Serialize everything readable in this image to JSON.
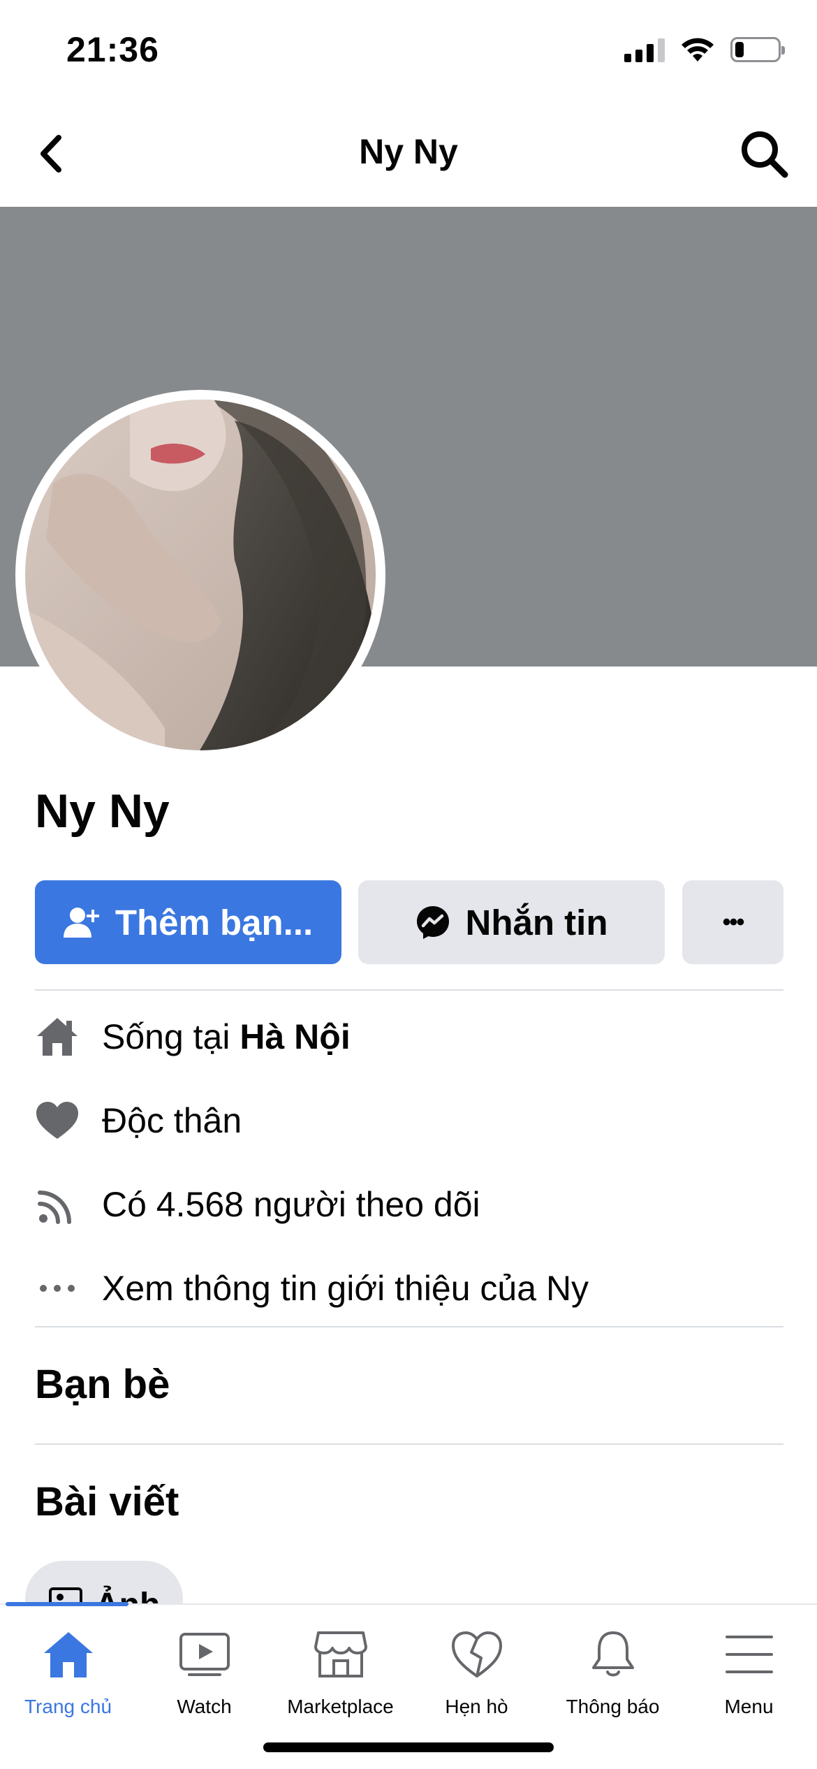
{
  "status_bar": {
    "time": "21:36",
    "battery_level": 0.2,
    "signal_icon": "signal-icon",
    "wifi_icon": "wifi-icon"
  },
  "header": {
    "title": "Ny Ny",
    "back_icon": "chevron-left-icon",
    "search_icon": "search-icon"
  },
  "profile": {
    "name": "Ny Ny",
    "cover_color": "#878a8d"
  },
  "actions": {
    "add_friend_label": "Thêm bạn...",
    "message_label": "Nhắn tin",
    "more_label": "•••"
  },
  "info": {
    "lives_prefix": "Sống tại ",
    "lives_city": "Hà Nội",
    "relationship": "Độc thân",
    "followers": "Có 4.568 người theo dõi",
    "see_about": "Xem thông tin giới thiệu của Ny"
  },
  "sections": {
    "friends_title": "Bạn bè",
    "posts_title": "Bài viết",
    "photos_chip": "Ảnh"
  },
  "tabbar": {
    "tabs": [
      {
        "label": "Trang chủ",
        "icon": "home-icon",
        "active": true
      },
      {
        "label": "Watch",
        "icon": "watch-icon",
        "active": false
      },
      {
        "label": "Marketplace",
        "icon": "marketplace-icon",
        "active": false
      },
      {
        "label": "Hẹn hò",
        "icon": "heart-icon",
        "active": false
      },
      {
        "label": "Thông báo",
        "icon": "bell-icon",
        "active": false
      },
      {
        "label": "Menu",
        "icon": "menu-icon",
        "active": false
      }
    ]
  },
  "colors": {
    "accent": "#3b77e0",
    "button_gray": "#e4e6eb",
    "icon_gray": "#65676b"
  }
}
